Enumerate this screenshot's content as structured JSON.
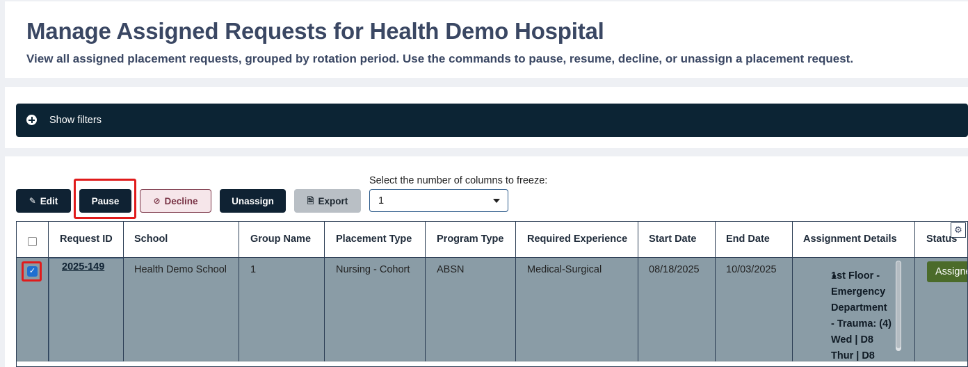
{
  "header": {
    "title": "Manage Assigned Requests for Health Demo Hospital",
    "subtitle": "View all assigned placement requests, grouped by rotation period. Use the commands to pause, resume, decline, or unassign a placement request."
  },
  "filters": {
    "label": "Show filters"
  },
  "toolbar": {
    "edit_label": "Edit",
    "pause_label": "Pause",
    "decline_label": "Decline",
    "unassign_label": "Unassign",
    "export_label": "Export",
    "freeze_label": "Select the number of columns to freeze:",
    "freeze_value": "1"
  },
  "table": {
    "headers": {
      "request_id": "Request ID",
      "school": "School",
      "group_name": "Group Name",
      "placement_type": "Placement Type",
      "program_type": "Program Type",
      "required_experience": "Required Experience",
      "start_date": "Start Date",
      "end_date": "End Date",
      "assignment_details": "Assignment Details",
      "status": "Status"
    },
    "rows": [
      {
        "checked": true,
        "request_id": "2025-149",
        "school": "Health Demo School",
        "group_name": "1",
        "placement_type": "Nursing - Cohort",
        "program_type": "ABSN",
        "required_experience": "Medical-Surgical",
        "start_date": "08/18/2025",
        "end_date": "10/03/2025",
        "assignment_lines": [
          "1st Floor -",
          "Emergency",
          "Department",
          "- Trauma: (4)",
          "Wed | D8",
          "Thur | D8"
        ],
        "status": "Assigne"
      }
    ]
  },
  "colors": {
    "title": "#3a4763",
    "filter_bar": "#0c2434",
    "button_dark": "#0f2233",
    "decline_bg": "#f6e6ea",
    "decline_border": "#7a3446",
    "selected_row": "#8a9ca6",
    "status_badge": "#4b6b2a",
    "highlight": "#e01b1b"
  },
  "icons": {
    "filters": "plus-circle-icon",
    "edit": "pencil-icon",
    "decline": "ban-icon",
    "export": "excel-file-icon",
    "select": "chevron-down-icon",
    "settings": "gear-icon"
  }
}
